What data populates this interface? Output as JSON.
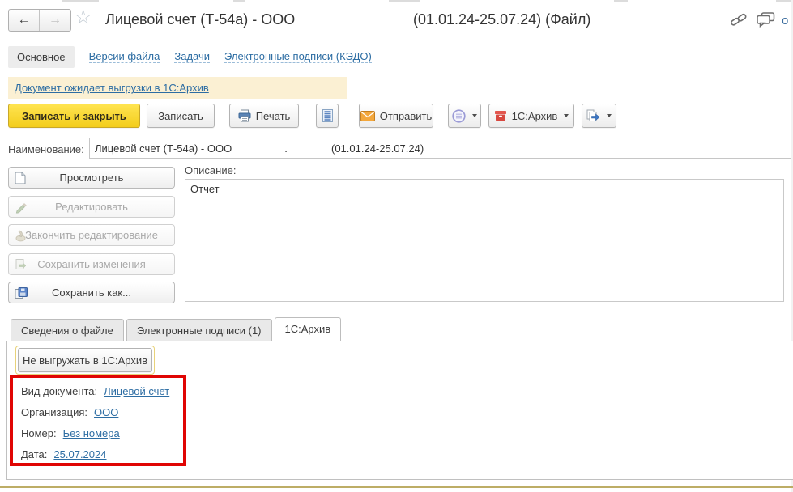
{
  "icons": {
    "back": "←",
    "forward": "→",
    "star": "☆",
    "partial_right": "о"
  },
  "header": {
    "title": "Лицевой счет (Т-54а) - ООО",
    "title_dates": "(01.01.24-25.07.24) (Файл)"
  },
  "nav": {
    "items": [
      {
        "label": "Основное"
      },
      {
        "label": "Версии файла"
      },
      {
        "label": "Задачи"
      },
      {
        "label": "Электронные подписи (КЭДО)"
      }
    ]
  },
  "banner": {
    "link_label": "Документ ожидает выгрузки в 1С:Архив"
  },
  "toolbar": {
    "save_and_close": "Записать и закрыть",
    "save": "Записать",
    "print": "Печать",
    "send": "Отправить",
    "archive": "1С:Архив"
  },
  "name_field": {
    "label": "Наименование:",
    "value": "Лицевой счет (Т-54а) - ООО                  .               (01.01.24-25.07.24)"
  },
  "file_actions": [
    {
      "label": "Просмотреть",
      "enabled": true
    },
    {
      "label": "Редактировать",
      "enabled": false
    },
    {
      "label": "Закончить редактирование",
      "enabled": false
    },
    {
      "label": "Сохранить изменения",
      "enabled": false
    },
    {
      "label": "Сохранить как...",
      "enabled": true
    }
  ],
  "description": {
    "label": "Описание:",
    "value": "Отчет"
  },
  "detail_tabs": [
    {
      "label": "Сведения о файле",
      "active": false
    },
    {
      "label": "Электронные подписи (1)",
      "active": false
    },
    {
      "label": "1С:Архив",
      "active": true
    }
  ],
  "archive_panel": {
    "skip_button": "Не выгружать в 1С:Архив",
    "fields": [
      {
        "label": "Вид документа:",
        "value": "Лицевой счет"
      },
      {
        "label": "Организация:",
        "value": "ООО"
      },
      {
        "label": "Номер:",
        "value": "Без номера"
      },
      {
        "label": "Дата:",
        "value": "25.07.2024"
      }
    ]
  },
  "colors": {
    "accent_yellow": "#f3cd1c",
    "link_blue": "#2d6da3",
    "warning_bg": "#fbf0d3",
    "annotation_red": "#e00503",
    "bottom_line": "#bdad66"
  }
}
